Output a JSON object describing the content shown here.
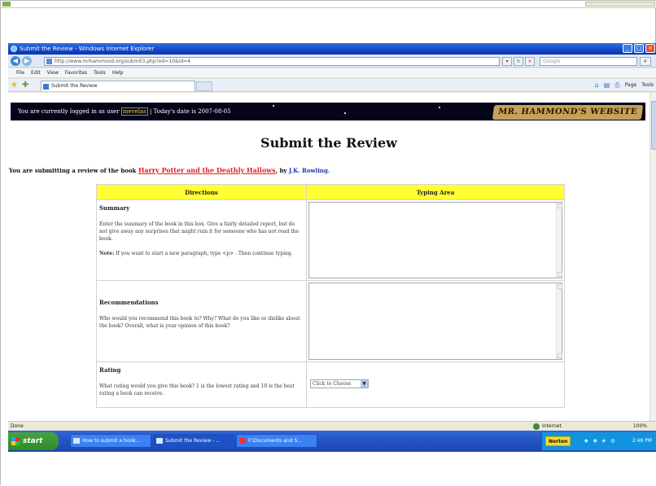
{
  "window": {
    "title": "Submit the Review - Windows Internet Explorer",
    "url": "http://www.mrhammond.org/submit3.php?ed=10&id=4",
    "search_placeholder": "Google",
    "menu": [
      "File",
      "Edit",
      "View",
      "Favorites",
      "Tools",
      "Help"
    ],
    "tab_title": "Submit the Review",
    "command_bar": [
      "Page",
      "Tools"
    ]
  },
  "banner": {
    "logged_prefix": "You are currently logged in as user",
    "username": "mevelas",
    "date_text": "| Today's date is 2007-08-05",
    "site_logo": "MR. HAMMOND'S WEBSITE"
  },
  "page": {
    "title": "Submit the Review",
    "sub_prefix": "You are submitting a review of the book",
    "book_title": "Harry Potter and the Deathly Hallows",
    "sub_by": ", by",
    "author": "J.K. Rowling."
  },
  "table": {
    "col_directions": "Directions",
    "col_typing": "Typing Area",
    "summary": {
      "heading": "Summary",
      "text1": "Enter the summary of the book in this box. Give a fairly detailed report, but do not give away any surprises that might ruin it for someone who has not read the book.",
      "note_label": "Note:",
      "note_text": "If you want to start a new paragraph, type <p> . Then continue typing."
    },
    "recommendations": {
      "heading": "Recommendations",
      "text": "Who would you recommend this book to? Why? What do you like or dislike about the book? Overall, what is your opinion of this book?"
    },
    "rating": {
      "heading": "Rating",
      "text": "What rating would you give this book? 1 is the lowest rating and 10 is the best rating a book can receive.",
      "select_value": "Click to Choose"
    }
  },
  "statusbar": {
    "status": "Done",
    "zone": "Internet",
    "zoom": "100%"
  },
  "taskbar": {
    "start": "start",
    "tasks": [
      "How to submit a book...",
      "Submit the Review - ...",
      "F:\\Documents and S..."
    ],
    "norton": "Norton",
    "clock": "2:48 PM"
  }
}
